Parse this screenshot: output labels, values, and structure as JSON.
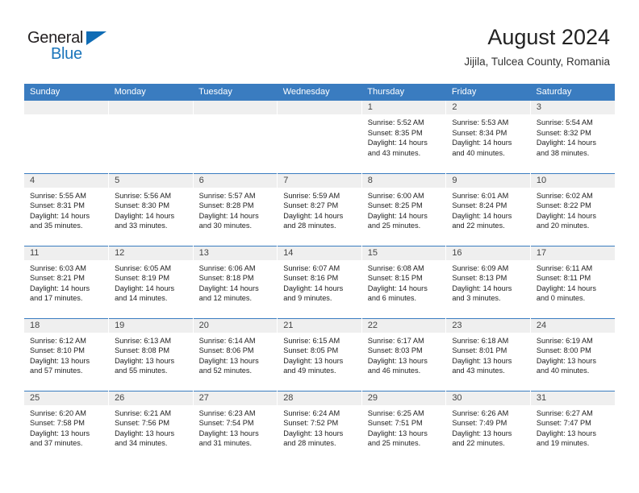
{
  "brand": {
    "name_top": "General",
    "name_bottom": "Blue",
    "accent_color": "#1b75bb"
  },
  "header": {
    "title": "August 2024",
    "subtitle": "Jijila, Tulcea County, Romania"
  },
  "theme": {
    "header_bar_color": "#3a7cc0",
    "day_number_bg": "#efefef",
    "cell_bg": "#ffffff",
    "text_color": "#222222"
  },
  "weekdays": [
    "Sunday",
    "Monday",
    "Tuesday",
    "Wednesday",
    "Thursday",
    "Friday",
    "Saturday"
  ],
  "labels": {
    "sunrise_prefix": "Sunrise:",
    "sunset_prefix": "Sunset:",
    "daylight_prefix": "Daylight:"
  },
  "weeks": [
    [
      {
        "empty": true
      },
      {
        "empty": true
      },
      {
        "empty": true
      },
      {
        "empty": true
      },
      {
        "day": "1",
        "sunrise": "Sunrise: 5:52 AM",
        "sunset": "Sunset: 8:35 PM",
        "daylight_1": "Daylight: 14 hours",
        "daylight_2": "and 43 minutes."
      },
      {
        "day": "2",
        "sunrise": "Sunrise: 5:53 AM",
        "sunset": "Sunset: 8:34 PM",
        "daylight_1": "Daylight: 14 hours",
        "daylight_2": "and 40 minutes."
      },
      {
        "day": "3",
        "sunrise": "Sunrise: 5:54 AM",
        "sunset": "Sunset: 8:32 PM",
        "daylight_1": "Daylight: 14 hours",
        "daylight_2": "and 38 minutes."
      }
    ],
    [
      {
        "day": "4",
        "sunrise": "Sunrise: 5:55 AM",
        "sunset": "Sunset: 8:31 PM",
        "daylight_1": "Daylight: 14 hours",
        "daylight_2": "and 35 minutes."
      },
      {
        "day": "5",
        "sunrise": "Sunrise: 5:56 AM",
        "sunset": "Sunset: 8:30 PM",
        "daylight_1": "Daylight: 14 hours",
        "daylight_2": "and 33 minutes."
      },
      {
        "day": "6",
        "sunrise": "Sunrise: 5:57 AM",
        "sunset": "Sunset: 8:28 PM",
        "daylight_1": "Daylight: 14 hours",
        "daylight_2": "and 30 minutes."
      },
      {
        "day": "7",
        "sunrise": "Sunrise: 5:59 AM",
        "sunset": "Sunset: 8:27 PM",
        "daylight_1": "Daylight: 14 hours",
        "daylight_2": "and 28 minutes."
      },
      {
        "day": "8",
        "sunrise": "Sunrise: 6:00 AM",
        "sunset": "Sunset: 8:25 PM",
        "daylight_1": "Daylight: 14 hours",
        "daylight_2": "and 25 minutes."
      },
      {
        "day": "9",
        "sunrise": "Sunrise: 6:01 AM",
        "sunset": "Sunset: 8:24 PM",
        "daylight_1": "Daylight: 14 hours",
        "daylight_2": "and 22 minutes."
      },
      {
        "day": "10",
        "sunrise": "Sunrise: 6:02 AM",
        "sunset": "Sunset: 8:22 PM",
        "daylight_1": "Daylight: 14 hours",
        "daylight_2": "and 20 minutes."
      }
    ],
    [
      {
        "day": "11",
        "sunrise": "Sunrise: 6:03 AM",
        "sunset": "Sunset: 8:21 PM",
        "daylight_1": "Daylight: 14 hours",
        "daylight_2": "and 17 minutes."
      },
      {
        "day": "12",
        "sunrise": "Sunrise: 6:05 AM",
        "sunset": "Sunset: 8:19 PM",
        "daylight_1": "Daylight: 14 hours",
        "daylight_2": "and 14 minutes."
      },
      {
        "day": "13",
        "sunrise": "Sunrise: 6:06 AM",
        "sunset": "Sunset: 8:18 PM",
        "daylight_1": "Daylight: 14 hours",
        "daylight_2": "and 12 minutes."
      },
      {
        "day": "14",
        "sunrise": "Sunrise: 6:07 AM",
        "sunset": "Sunset: 8:16 PM",
        "daylight_1": "Daylight: 14 hours",
        "daylight_2": "and 9 minutes."
      },
      {
        "day": "15",
        "sunrise": "Sunrise: 6:08 AM",
        "sunset": "Sunset: 8:15 PM",
        "daylight_1": "Daylight: 14 hours",
        "daylight_2": "and 6 minutes."
      },
      {
        "day": "16",
        "sunrise": "Sunrise: 6:09 AM",
        "sunset": "Sunset: 8:13 PM",
        "daylight_1": "Daylight: 14 hours",
        "daylight_2": "and 3 minutes."
      },
      {
        "day": "17",
        "sunrise": "Sunrise: 6:11 AM",
        "sunset": "Sunset: 8:11 PM",
        "daylight_1": "Daylight: 14 hours",
        "daylight_2": "and 0 minutes."
      }
    ],
    [
      {
        "day": "18",
        "sunrise": "Sunrise: 6:12 AM",
        "sunset": "Sunset: 8:10 PM",
        "daylight_1": "Daylight: 13 hours",
        "daylight_2": "and 57 minutes."
      },
      {
        "day": "19",
        "sunrise": "Sunrise: 6:13 AM",
        "sunset": "Sunset: 8:08 PM",
        "daylight_1": "Daylight: 13 hours",
        "daylight_2": "and 55 minutes."
      },
      {
        "day": "20",
        "sunrise": "Sunrise: 6:14 AM",
        "sunset": "Sunset: 8:06 PM",
        "daylight_1": "Daylight: 13 hours",
        "daylight_2": "and 52 minutes."
      },
      {
        "day": "21",
        "sunrise": "Sunrise: 6:15 AM",
        "sunset": "Sunset: 8:05 PM",
        "daylight_1": "Daylight: 13 hours",
        "daylight_2": "and 49 minutes."
      },
      {
        "day": "22",
        "sunrise": "Sunrise: 6:17 AM",
        "sunset": "Sunset: 8:03 PM",
        "daylight_1": "Daylight: 13 hours",
        "daylight_2": "and 46 minutes."
      },
      {
        "day": "23",
        "sunrise": "Sunrise: 6:18 AM",
        "sunset": "Sunset: 8:01 PM",
        "daylight_1": "Daylight: 13 hours",
        "daylight_2": "and 43 minutes."
      },
      {
        "day": "24",
        "sunrise": "Sunrise: 6:19 AM",
        "sunset": "Sunset: 8:00 PM",
        "daylight_1": "Daylight: 13 hours",
        "daylight_2": "and 40 minutes."
      }
    ],
    [
      {
        "day": "25",
        "sunrise": "Sunrise: 6:20 AM",
        "sunset": "Sunset: 7:58 PM",
        "daylight_1": "Daylight: 13 hours",
        "daylight_2": "and 37 minutes."
      },
      {
        "day": "26",
        "sunrise": "Sunrise: 6:21 AM",
        "sunset": "Sunset: 7:56 PM",
        "daylight_1": "Daylight: 13 hours",
        "daylight_2": "and 34 minutes."
      },
      {
        "day": "27",
        "sunrise": "Sunrise: 6:23 AM",
        "sunset": "Sunset: 7:54 PM",
        "daylight_1": "Daylight: 13 hours",
        "daylight_2": "and 31 minutes."
      },
      {
        "day": "28",
        "sunrise": "Sunrise: 6:24 AM",
        "sunset": "Sunset: 7:52 PM",
        "daylight_1": "Daylight: 13 hours",
        "daylight_2": "and 28 minutes."
      },
      {
        "day": "29",
        "sunrise": "Sunrise: 6:25 AM",
        "sunset": "Sunset: 7:51 PM",
        "daylight_1": "Daylight: 13 hours",
        "daylight_2": "and 25 minutes."
      },
      {
        "day": "30",
        "sunrise": "Sunrise: 6:26 AM",
        "sunset": "Sunset: 7:49 PM",
        "daylight_1": "Daylight: 13 hours",
        "daylight_2": "and 22 minutes."
      },
      {
        "day": "31",
        "sunrise": "Sunrise: 6:27 AM",
        "sunset": "Sunset: 7:47 PM",
        "daylight_1": "Daylight: 13 hours",
        "daylight_2": "and 19 minutes."
      }
    ]
  ]
}
